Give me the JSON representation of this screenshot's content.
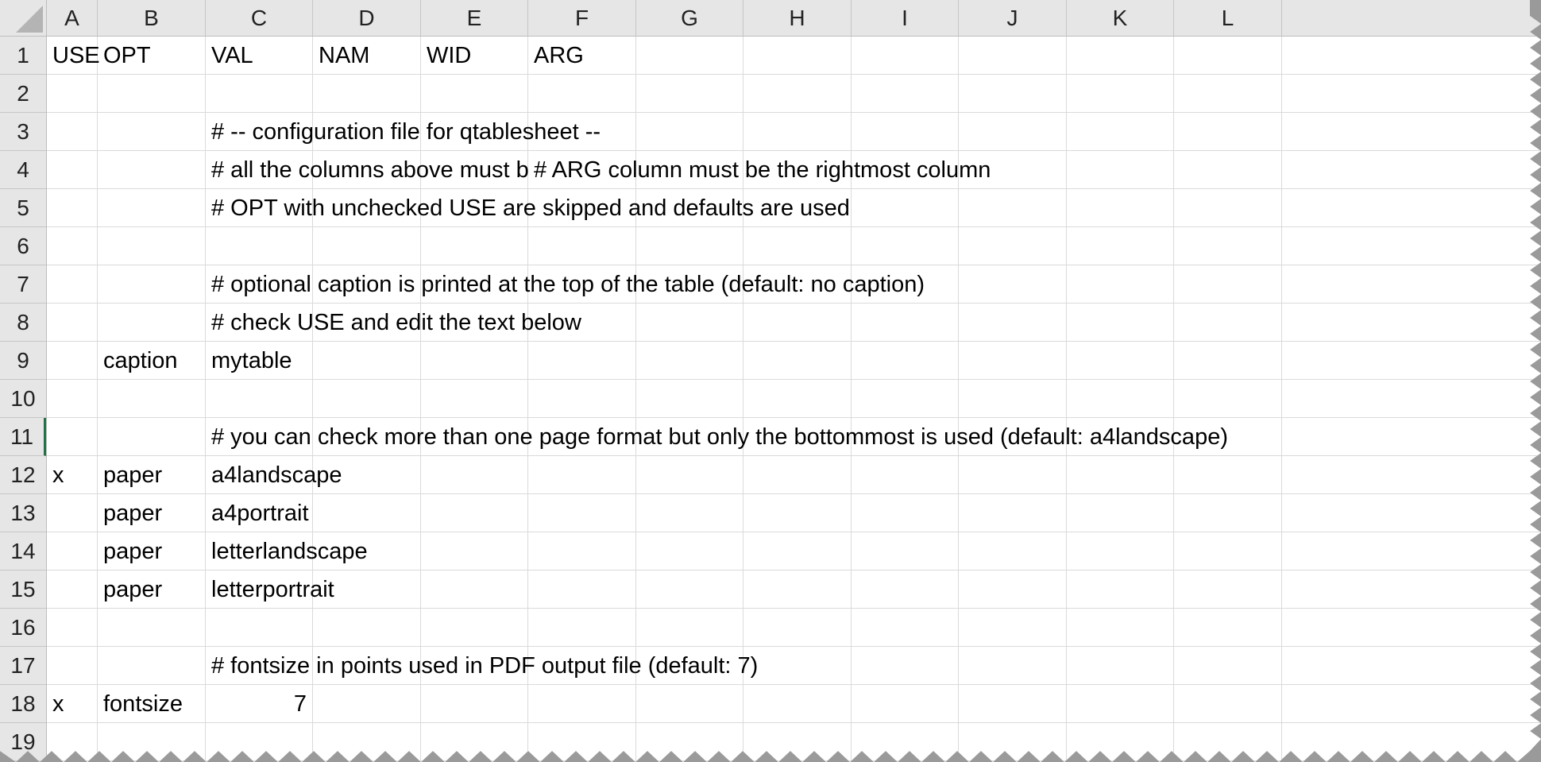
{
  "columns": [
    "A",
    "B",
    "C",
    "D",
    "E",
    "F",
    "G",
    "H",
    "I",
    "J",
    "K",
    "L"
  ],
  "rows": [
    "1",
    "2",
    "3",
    "4",
    "5",
    "6",
    "7",
    "8",
    "9",
    "10",
    "11",
    "12",
    "13",
    "14",
    "15",
    "16",
    "17",
    "18",
    "19"
  ],
  "active_row": "11",
  "cells": {
    "A1": "USE",
    "B1": "OPT",
    "C1": "VAL",
    "D1": "NAM",
    "E1": "WID",
    "F1": "ARG",
    "C3": "# --  configuration file for qtablesheet --",
    "C4": "# all the columns above must be a",
    "F4": "# ARG column must be the rightmost column",
    "C5": "# OPT with unchecked USE are skipped and defaults are used",
    "C7": "# optional caption is printed at the top of the table (default: no caption)",
    "C8": "# check USE and edit the text below",
    "B9": "caption",
    "C9": "mytable",
    "C11": "# you can check more than one page format but only the bottommost is used (default: a4landscape)",
    "A12": "x",
    "B12": "paper",
    "C12": "a4landscape",
    "B13": "paper",
    "C13": "a4portrait",
    "B14": "paper",
    "C14": "letterlandscape",
    "B15": "paper",
    "C15": "letterportrait",
    "C17": "# fontsize in points used in PDF output file (default: 7)",
    "A18": "x",
    "B18": "fontsize",
    "C18": "7"
  },
  "colors": {
    "header_bg": "#e6e6e6",
    "gridline": "#dadada",
    "active_accent": "#217346"
  }
}
